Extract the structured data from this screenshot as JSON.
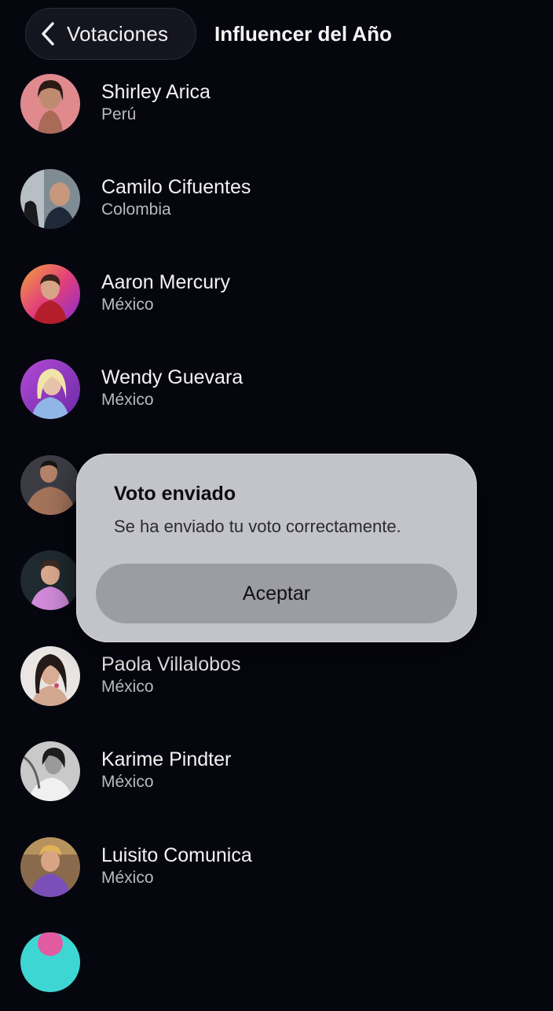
{
  "nav": {
    "back_label": "Votaciones",
    "title": "Influencer del Año"
  },
  "candidates": [
    {
      "name": "Shirley Arica",
      "country": "Perú"
    },
    {
      "name": "Camilo Cifuentes",
      "country": "Colombia"
    },
    {
      "name": "Aaron Mercury",
      "country": "México"
    },
    {
      "name": "Wendy Guevara",
      "country": "México"
    },
    {
      "name": "",
      "country": ""
    },
    {
      "name": "",
      "country": ""
    },
    {
      "name": "Paola Villalobos",
      "country": "México"
    },
    {
      "name": "Karime Pindter",
      "country": "México"
    },
    {
      "name": "Luisito Comunica",
      "country": "México"
    },
    {
      "name": "",
      "country": ""
    }
  ],
  "dialog": {
    "title": "Voto enviado",
    "message": "Se ha enviado tu voto correctamente.",
    "button_label": "Aceptar"
  },
  "colors": {
    "background": "#06060f",
    "dialog_background": "#c3c3ca",
    "dialog_button": "#9c9ca4"
  }
}
